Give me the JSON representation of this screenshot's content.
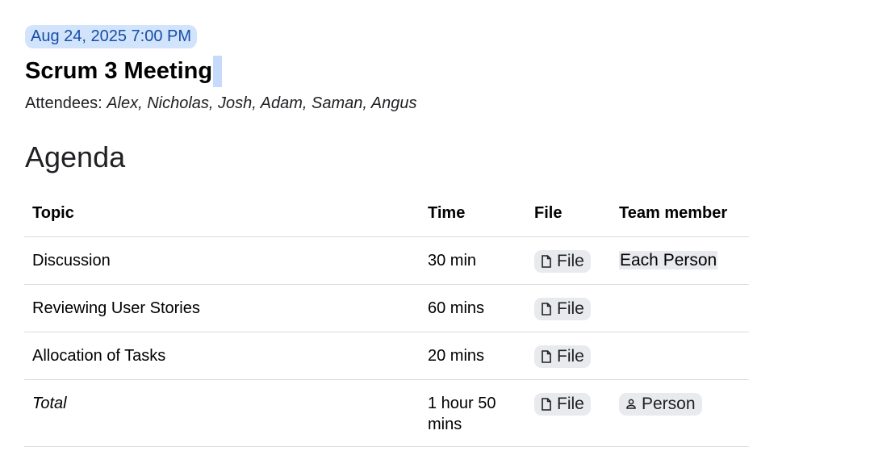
{
  "meeting": {
    "date_chip": "Aug 24, 2025 7:00 PM",
    "title": "Scrum 3 Meeting",
    "attendees_label": "Attendees: ",
    "attendees_names": "Alex, Nicholas, Josh, Adam, Saman, Angus"
  },
  "agenda": {
    "heading": "Agenda",
    "columns": [
      "Topic",
      "Time",
      "File",
      "Team member"
    ],
    "rows": [
      {
        "topic": "Discussion",
        "time": "30 min",
        "file": "File",
        "member": "Each Person"
      },
      {
        "topic": "Reviewing User Stories",
        "time": "60 mins",
        "file": "File",
        "member": ""
      },
      {
        "topic": "Allocation of Tasks",
        "time": "20 mins",
        "file": "File",
        "member": ""
      },
      {
        "topic": "Total",
        "time": "1 hour 50 mins",
        "file": "File",
        "member": "Person"
      }
    ]
  },
  "icons": {
    "file_chip": "file-icon",
    "person_chip": "person-icon"
  },
  "colors": {
    "date_chip_bg": "#d2e3fc",
    "date_chip_text": "#174ea6",
    "chip_bg": "#e8eaed",
    "selection": "#c6dafc"
  }
}
